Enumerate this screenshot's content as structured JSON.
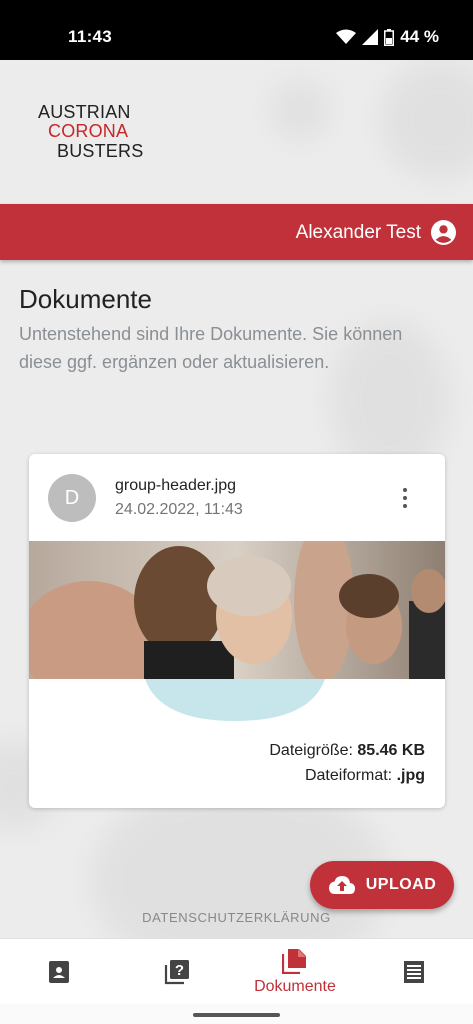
{
  "status": {
    "time": "11:43",
    "battery": "44 %"
  },
  "logo": {
    "line1": "AUSTRIAN",
    "line2": "CORONA",
    "line3": "BUSTERS"
  },
  "header": {
    "user_name": "Alexander Test"
  },
  "page": {
    "title": "Dokumente",
    "subtitle": "Untenstehend sind Ihre Dokumente. Sie können diese ggf. ergänzen oder aktualisieren."
  },
  "document": {
    "avatar_letter": "D",
    "file_name": "group-header.jpg",
    "date": "24.02.2022, 11:43",
    "size_label": "Dateigröße:",
    "size_value": "85.46 KB",
    "format_label": "Dateiformat:",
    "format_value": ".jpg"
  },
  "upload_label": "UPLOAD",
  "privacy_label": "DATENSCHUTZERKLÄRUNG",
  "nav": {
    "active_label": "Dokumente"
  },
  "colors": {
    "accent": "#c0313a",
    "status_bar": "#000000",
    "muted_text": "#8a8f94"
  }
}
